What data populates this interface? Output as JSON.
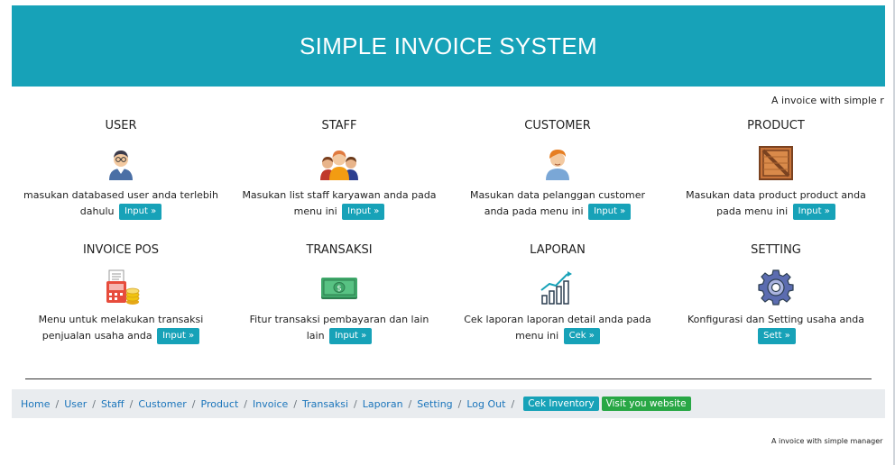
{
  "header": {
    "title": "SIMPLE INVOICE SYSTEM"
  },
  "marquee_top": "A invoice with simple r",
  "cards": [
    {
      "title": "USER",
      "desc": "masukan databased user anda terlebih dahulu",
      "button": "Input »",
      "icon": "user-avatar-icon"
    },
    {
      "title": "STAFF",
      "desc": "Masukan list staff karyawan anda pada menu ini",
      "button": "Input »",
      "icon": "staff-group-icon"
    },
    {
      "title": "CUSTOMER",
      "desc": "Masukan data pelanggan customer anda pada menu ini",
      "button": "Input »",
      "icon": "customer-icon"
    },
    {
      "title": "PRODUCT",
      "desc": "Masukan data product product anda pada menu ini",
      "button": "Input »",
      "icon": "crate-icon"
    },
    {
      "title": "INVOICE POS",
      "desc": "Menu untuk melakukan transaksi penjualan usaha anda",
      "button": "Input »",
      "icon": "pos-terminal-icon"
    },
    {
      "title": "TRANSAKSI",
      "desc": "Fitur transaksi pembayaran dan lain lain",
      "button": "Input »",
      "icon": "money-icon"
    },
    {
      "title": "LAPORAN",
      "desc": "Cek laporan laporan detail anda pada menu ini",
      "button": "Cek »",
      "icon": "chart-growth-icon"
    },
    {
      "title": "SETTING",
      "desc": "Konfigurasi dan Setting usaha anda",
      "button": "Sett »",
      "icon": "gear-icon"
    }
  ],
  "breadcrumb": {
    "items": [
      "Home",
      "User",
      "Staff",
      "Customer",
      "Product",
      "Invoice",
      "Transaksi",
      "Laporan",
      "Setting",
      "Log Out"
    ],
    "badge_inventory": "Cek Inventory",
    "badge_website": "Visit you website"
  },
  "footer_marquee": "A invoice with simple manager",
  "colors": {
    "primary": "#17a2b8",
    "success": "#28a745",
    "link": "#1b75bb"
  }
}
